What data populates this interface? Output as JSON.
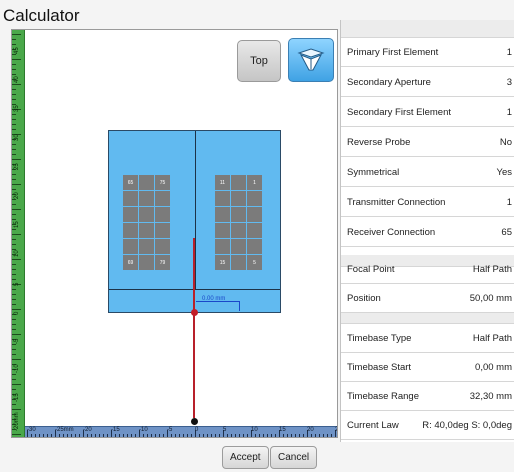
{
  "window": {
    "title": "Calculator"
  },
  "view": {
    "top_button": "Top",
    "offset_label": "0.00 mm",
    "ruler_v_labels": [
      "45",
      "40",
      "35",
      "30",
      "25",
      "20",
      "15",
      "10",
      "5",
      "0",
      "-5",
      "-10",
      "-15",
      "-20mm"
    ],
    "ruler_h_labels": [
      "-30",
      "-25mm",
      "-20",
      "-15",
      "-10",
      "-5",
      "0",
      "5",
      "10",
      "15",
      "20",
      "25"
    ],
    "left_grid": [
      "65",
      "",
      "75",
      "",
      "",
      "",
      "",
      "",
      "",
      "",
      "",
      "",
      "",
      "",
      "",
      "69",
      "",
      "79"
    ],
    "right_grid": [
      "11",
      "",
      "1",
      "",
      "",
      "",
      "",
      "",
      "",
      "",
      "",
      "",
      "",
      "",
      "",
      "15",
      "",
      "5"
    ]
  },
  "properties": {
    "group1": [
      {
        "label": "Primary First Element",
        "value": "1"
      },
      {
        "label": "Secondary Aperture",
        "value": "3"
      },
      {
        "label": "Secondary First Element",
        "value": "1"
      },
      {
        "label": "Reverse Probe",
        "value": "No"
      },
      {
        "label": "Symmetrical",
        "value": "Yes"
      },
      {
        "label": "Transmitter Connection",
        "value": "1"
      },
      {
        "label": "Receiver Connection",
        "value": "65"
      }
    ],
    "group2": [
      {
        "label": "Focal Point",
        "value": "Half Path"
      },
      {
        "label": "Position",
        "value": "50,00 mm"
      }
    ],
    "group3": [
      {
        "label": "Timebase Type",
        "value": "Half Path"
      },
      {
        "label": "Timebase Start",
        "value": "0,00 mm"
      },
      {
        "label": "Timebase Range",
        "value": "32,30 mm"
      },
      {
        "label": "Current Law",
        "value": "R: 40,0deg S: 0,0deg"
      }
    ]
  },
  "footer": {
    "accept": "Accept",
    "cancel": "Cancel"
  }
}
